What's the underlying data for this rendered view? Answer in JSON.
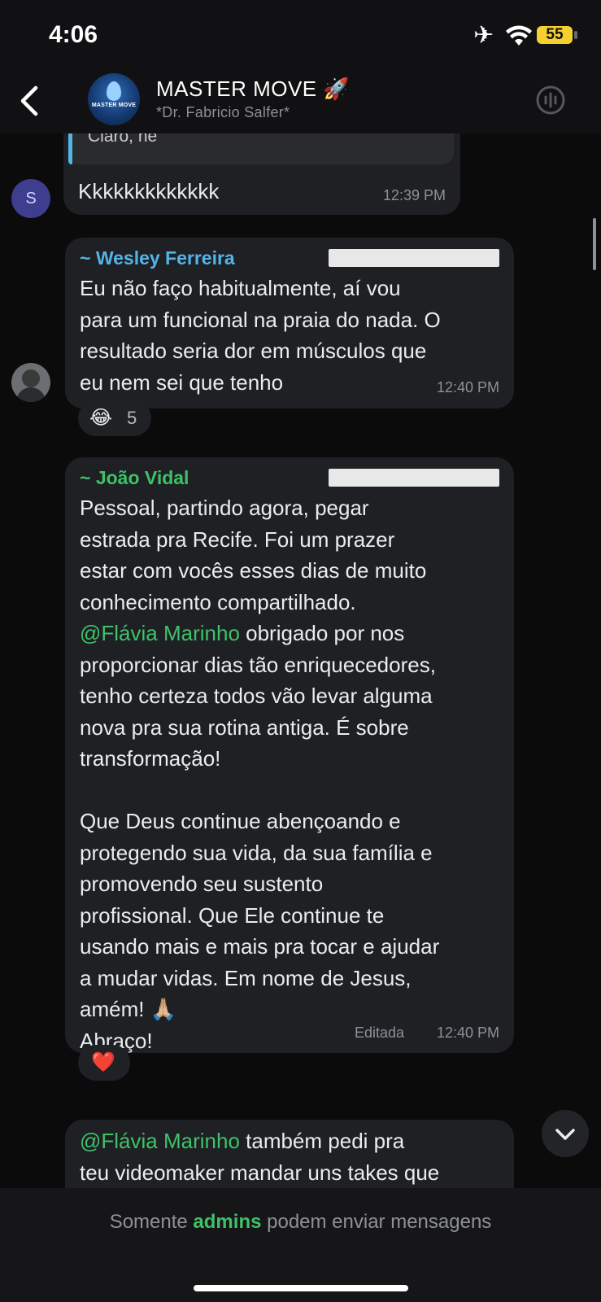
{
  "status_bar": {
    "time": "4:06",
    "battery": "55"
  },
  "header": {
    "title": "MASTER MOVE 🚀",
    "subtitle": "*Dr. Fabricio Salfer*",
    "avatar_logo_text": "MASTER MOVE"
  },
  "messages": [
    {
      "sender_initial": "S",
      "quoted_text": "Claro, né",
      "text": "Kkkkkkkkkkkkk",
      "time": "12:39 PM"
    },
    {
      "sender": "~ Wesley Ferreira",
      "text": "Eu não faço habitualmente, aí vou\npara um funcional na praia do nada. O\nresultado seria dor em músculos que\neu nem sei que tenho",
      "time": "12:40 PM",
      "reaction_emoji": "😂",
      "reaction_count": "5"
    },
    {
      "sender": "~ João Vidal",
      "lines_before_mention": "Pessoal, partindo agora, pegar\nestrada pra Recife. Foi um prazer\nestar com vocês esses dias de muito\nconhecimento compartilhado.\n",
      "mention": "@Flávia Marinho",
      "text_after_mention": " obrigado por nos\nproporcionar dias tão enriquecedores,\ntenho certeza todos vão levar alguma\nnova pra sua rotina antiga. É sobre\ntransformação!\n\nQue Deus continue abençoando e\nprotegendo sua vida, da sua família e\npromovendo seu sustento\nprofissional. Que Ele continue te\nusando mais e mais pra tocar e ajudar\na mudar vidas. Em nome de Jesus,\namém! 🙏🏼\nAbraço!",
      "edited_label": "Editada",
      "time": "12:40 PM",
      "reaction_emoji": "❤️"
    },
    {
      "mention": "@Flávia Marinho",
      "text_after_mention": " também pedi pra\nteu videomaker mandar uns takes que"
    }
  ],
  "footer": {
    "notice_before": "Somente ",
    "notice_admins": "admins",
    "notice_after": " podem enviar mensagens"
  },
  "colors": {
    "background": "#0b0b0c",
    "bubble": "#1f2023",
    "sender_wesley": "#53b4e8",
    "sender_joao": "#3ec169",
    "mention": "#3ec169",
    "avatar_s": "#3e3d8e"
  }
}
